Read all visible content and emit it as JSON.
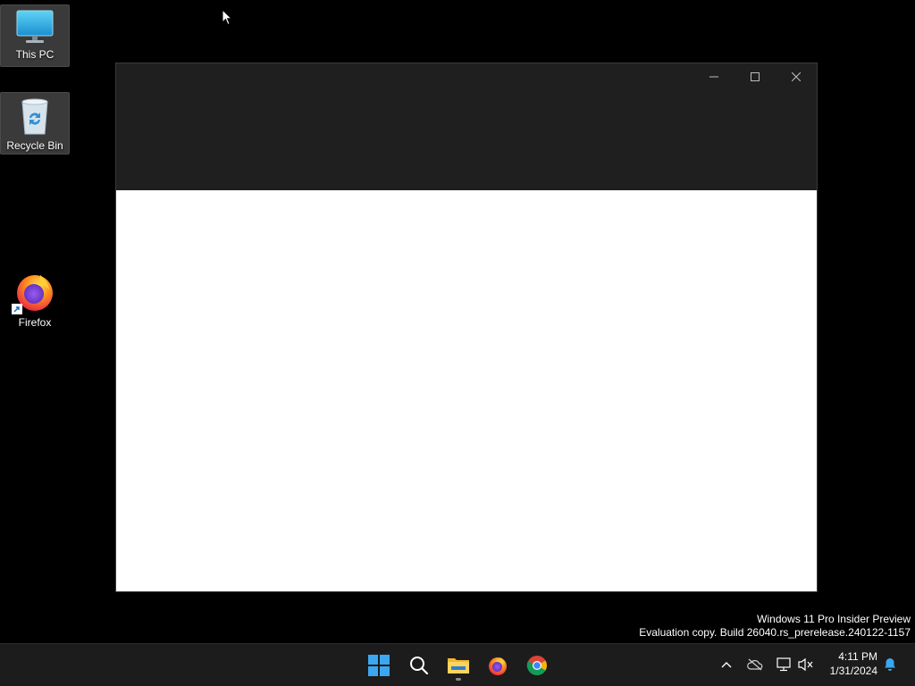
{
  "desktop": {
    "icons": [
      {
        "label": "This PC",
        "icon": "monitor-icon"
      },
      {
        "label": "Recycle Bin",
        "icon": "recycle-bin-icon"
      },
      {
        "label": "Firefox",
        "icon": "firefox-icon"
      }
    ]
  },
  "window": {
    "title": "",
    "controls": {
      "minimize": "minimize-icon",
      "maximize": "maximize-icon",
      "close": "close-icon"
    }
  },
  "watermark": {
    "line1": "Windows 11 Pro Insider Preview",
    "line2": "Evaluation copy. Build 26040.rs_prerelease.240122-1157"
  },
  "taskbar": {
    "apps": [
      {
        "name": "start",
        "icon": "windows-start-icon"
      },
      {
        "name": "search",
        "icon": "search-icon"
      },
      {
        "name": "file-explorer",
        "icon": "folder-icon",
        "running": true
      },
      {
        "name": "firefox",
        "icon": "firefox-icon"
      },
      {
        "name": "chrome",
        "icon": "chrome-icon"
      }
    ],
    "tray": [
      "chevron-up-icon",
      "onedrive-icon",
      "network-icon",
      "volume-muted-icon"
    ],
    "clock": {
      "time": "4:11 PM",
      "date": "1/31/2024"
    },
    "notification_icon": "bell-icon"
  },
  "colors": {
    "desktop_bg": "#000000",
    "taskbar_bg": "#1c1c1c",
    "titlebar_bg": "#1f1f1f",
    "content_bg": "#ffffff",
    "accent": "#0078d4"
  }
}
